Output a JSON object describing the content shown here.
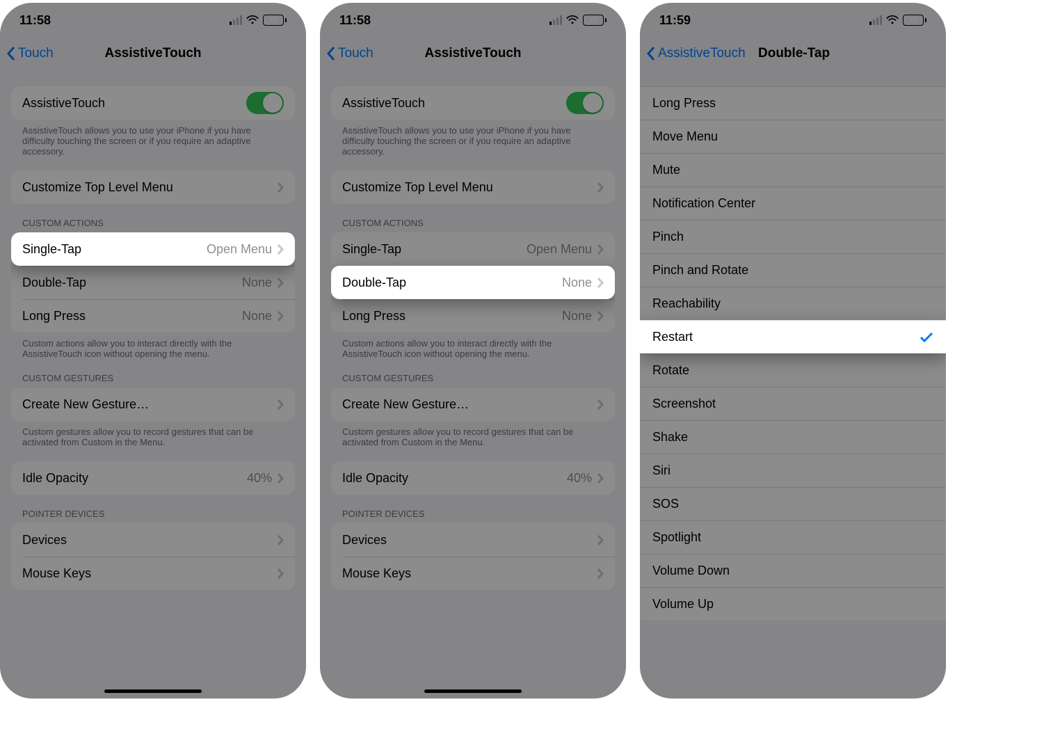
{
  "status": {
    "time12": "11:58",
    "time3": "11:59",
    "battery_level": "72",
    "battery_fill_pct": 72,
    "signal_bars_active": 1
  },
  "colors": {
    "accent": "#007aff",
    "toggle_on": "#34c759"
  },
  "screen1": {
    "nav_back": "Touch",
    "nav_title": "AssistiveTouch",
    "toggle_label": "AssistiveTouch",
    "toggle_on": true,
    "toggle_footer": "AssistiveTouch allows you to use your iPhone if you have difficulty touching the screen or if you require an adaptive accessory.",
    "customize_row": "Customize Top Level Menu",
    "custom_actions_header": "CUSTOM ACTIONS",
    "actions": {
      "single_tap": {
        "label": "Single-Tap",
        "value": "Open Menu"
      },
      "double_tap": {
        "label": "Double-Tap",
        "value": "None"
      },
      "long_press": {
        "label": "Long Press",
        "value": "None"
      }
    },
    "actions_footer": "Custom actions allow you to interact directly with the AssistiveTouch icon without opening the menu.",
    "gestures_header": "CUSTOM GESTURES",
    "create_gesture": "Create New Gesture…",
    "gestures_footer": "Custom gestures allow you to record gestures that can be activated from Custom in the Menu.",
    "idle_opacity_label": "Idle Opacity",
    "idle_opacity_value": "40%",
    "pointer_header": "POINTER DEVICES",
    "devices": "Devices",
    "mouse_keys": "Mouse Keys",
    "highlighted_row": "single_tap"
  },
  "screen2": {
    "nav_back": "Touch",
    "nav_title": "AssistiveTouch",
    "highlighted_row": "double_tap"
  },
  "screen3": {
    "nav_back": "AssistiveTouch",
    "nav_title": "Double-Tap",
    "options": [
      "Long Press",
      "Move Menu",
      "Mute",
      "Notification Center",
      "Pinch",
      "Pinch and Rotate",
      "Reachability",
      "Restart",
      "Rotate",
      "Screenshot",
      "Shake",
      "Siri",
      "SOS",
      "Spotlight",
      "Volume Down",
      "Volume Up"
    ],
    "selected": "Restart"
  }
}
